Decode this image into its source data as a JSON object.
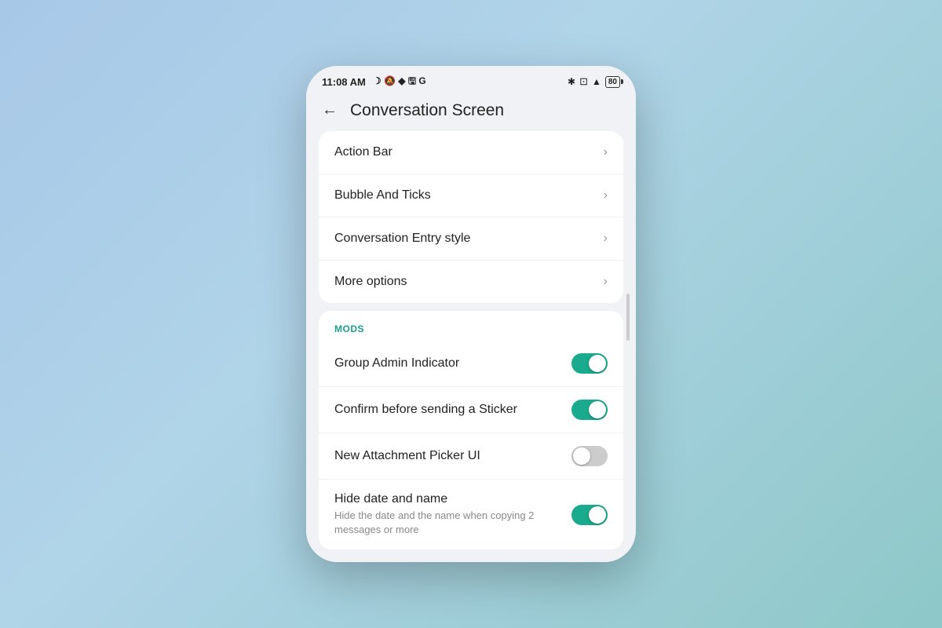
{
  "status_bar": {
    "time": "11:08 AM",
    "icons_left": "🌙 📵 📌 🗓 G",
    "icons_right": "* ⊡ ▲ 80"
  },
  "header": {
    "back_label": "←",
    "title": "Conversation Screen"
  },
  "nav_card": {
    "items": [
      {
        "label": "Action Bar"
      },
      {
        "label": "Bubble And Ticks"
      },
      {
        "label": "Conversation Entry style"
      },
      {
        "label": "More options"
      }
    ],
    "chevron": "›"
  },
  "mods_card": {
    "section_label": "MODS",
    "items": [
      {
        "label": "Group Admin Indicator",
        "sub": "",
        "toggle_state": "on"
      },
      {
        "label": "Confirm before sending a Sticker",
        "sub": "",
        "toggle_state": "on"
      },
      {
        "label": "New Attachment Picker UI",
        "sub": "",
        "toggle_state": "off"
      },
      {
        "label": "Hide date and name",
        "sub": "Hide the date and the name when copying 2 messages or more",
        "toggle_state": "on"
      }
    ]
  }
}
